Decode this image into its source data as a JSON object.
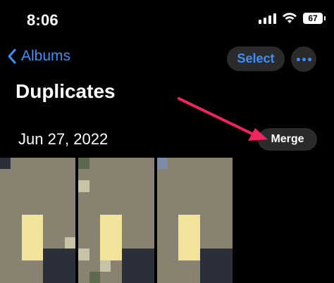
{
  "status_bar": {
    "time": "8:06",
    "battery": "67"
  },
  "nav": {
    "back_label": "Albums",
    "select_label": "Select"
  },
  "page": {
    "title": "Duplicates"
  },
  "group": {
    "date": "Jun 27, 2022",
    "merge_label": "Merge"
  },
  "colors": {
    "accent": "#3e8ef7",
    "button_bg": "#2b2b2d",
    "annotation_arrow": "#f0245e"
  },
  "icons": [
    "chevron-left-icon",
    "ellipsis-icon",
    "cellular-signal-icon",
    "wifi-icon",
    "battery-icon"
  ]
}
